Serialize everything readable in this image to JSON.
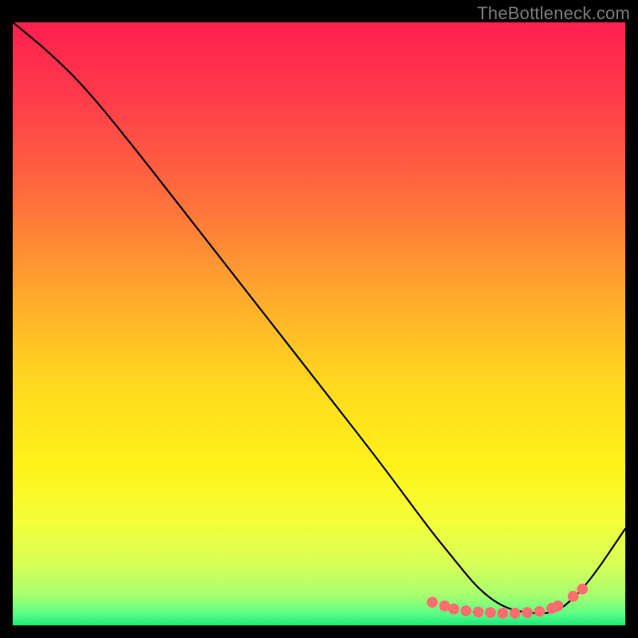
{
  "watermark": "TheBottleneck.com",
  "chart_data": {
    "type": "line",
    "title": "",
    "xlabel": "",
    "ylabel": "",
    "xlim": [
      0,
      100
    ],
    "ylim": [
      0,
      100
    ],
    "grid": false,
    "legend": false,
    "background_gradient": {
      "stops": [
        {
          "pct": 0,
          "color": "#ff1f4f"
        },
        {
          "pct": 12,
          "color": "#ff3a4a"
        },
        {
          "pct": 28,
          "color": "#ff6a3e"
        },
        {
          "pct": 45,
          "color": "#ffa82d"
        },
        {
          "pct": 60,
          "color": "#ffd91e"
        },
        {
          "pct": 74,
          "color": "#fff31a"
        },
        {
          "pct": 83,
          "color": "#f2ff3a"
        },
        {
          "pct": 90,
          "color": "#d6ff58"
        },
        {
          "pct": 95,
          "color": "#a8ff70"
        },
        {
          "pct": 98,
          "color": "#5fff86"
        },
        {
          "pct": 100,
          "color": "#17e97a"
        }
      ]
    },
    "series": [
      {
        "name": "curve",
        "color": "#000000",
        "x": [
          0,
          6,
          12,
          20,
          30,
          40,
          50,
          60,
          68,
          72,
          76,
          80,
          84,
          88,
          90,
          94,
          100
        ],
        "y": [
          100,
          95,
          89,
          79,
          66,
          53,
          40,
          27,
          16,
          11,
          6,
          3,
          2,
          2,
          3,
          7,
          16
        ]
      }
    ],
    "markers": {
      "name": "dots",
      "color": "#ff6e6e",
      "radius_data_units": 0.9,
      "x": [
        68.5,
        70.5,
        72,
        74,
        76,
        78,
        80,
        82,
        84,
        86,
        88,
        89,
        91.5,
        93
      ],
      "y": [
        3.8,
        3.2,
        2.7,
        2.4,
        2.2,
        2.1,
        2.0,
        2.0,
        2.1,
        2.3,
        2.8,
        3.2,
        4.8,
        6.0
      ]
    }
  }
}
